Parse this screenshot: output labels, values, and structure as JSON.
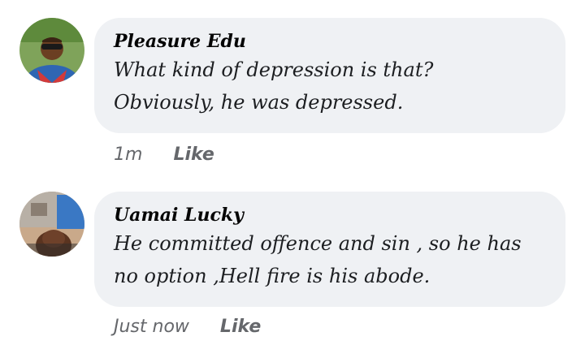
{
  "comments": [
    {
      "author": "Pleasure Edu",
      "lines": [
        "What kind of depression is that?",
        "Obviously, he was depressed."
      ],
      "time": "1m",
      "like_label": "Like"
    },
    {
      "author": "Uamai Lucky",
      "lines": [
        "He committed offence and sin , so he has",
        "no option ,Hell fire is his abode."
      ],
      "time": "Just now",
      "like_label": "Like"
    }
  ],
  "colors": {
    "bubble_bg": "#eff1f4",
    "action_text": "#65676b",
    "author_text": "#050505"
  }
}
